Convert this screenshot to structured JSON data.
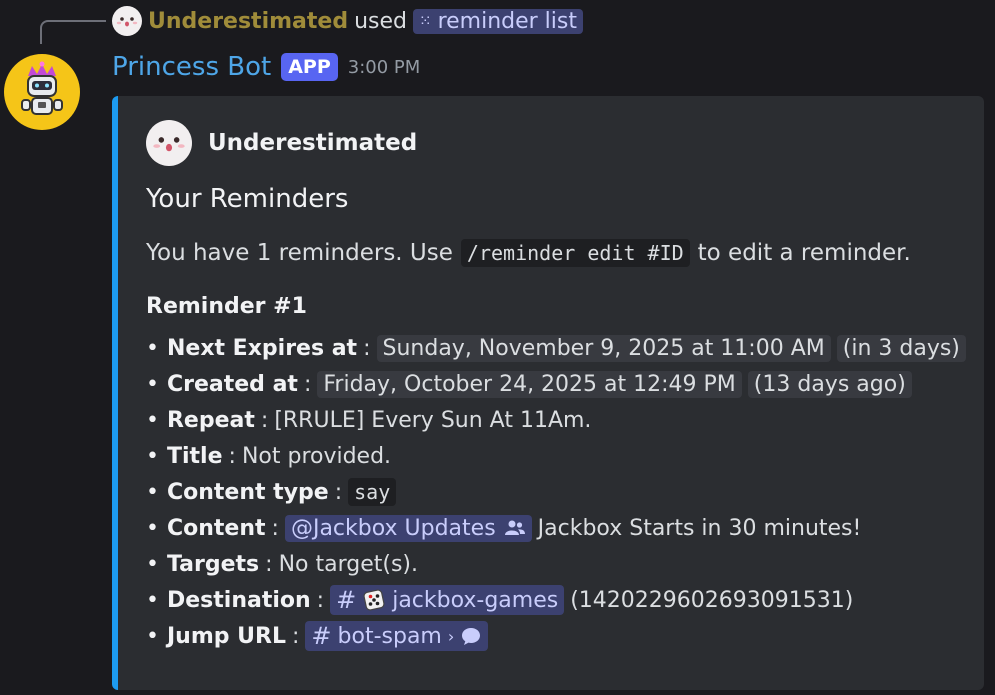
{
  "reply": {
    "username": "Underestimated",
    "used_text": "used",
    "command": "reminder list"
  },
  "message": {
    "bot_name": "Princess Bot",
    "badge": "APP",
    "time": "3:00 PM"
  },
  "embed": {
    "author": "Underestimated",
    "title": "Your Reminders",
    "desc_before": "You have 1 reminders. Use",
    "desc_code": "/reminder edit #ID",
    "desc_after": "to edit a reminder.",
    "field_name": "Reminder #1",
    "items": {
      "next": {
        "label": "Next Expires at",
        "value": "Sunday, November 9, 2025 at 11:00 AM",
        "relative": "in 3 days"
      },
      "created": {
        "label": "Created at",
        "value": "Friday, October 24, 2025 at 12:49 PM",
        "relative": "13 days ago"
      },
      "repeat": {
        "label": "Repeat",
        "value": "[RRULE] Every Sun At 11Am."
      },
      "title": {
        "label": "Title",
        "value": "Not provided."
      },
      "content_type": {
        "label": "Content type",
        "value": "say"
      },
      "content": {
        "label": "Content",
        "mention": "@Jackbox Updates",
        "text": "Jackbox Starts in 30 minutes!"
      },
      "targets": {
        "label": "Targets",
        "value": "No target(s)."
      },
      "destination": {
        "label": "Destination",
        "channel": "jackbox-games",
        "id": "(1420229602693091531)"
      },
      "jump": {
        "label": "Jump URL",
        "channel": "bot-spam"
      }
    }
  },
  "colors": {
    "accent": "#1d9bf0",
    "bot_name": "#4ea6e8",
    "badge": "#5865f2",
    "mention_bg": "#3c4170",
    "reply_name": "#a08c3a",
    "avatar_bg": "#f5c518"
  },
  "icons": {
    "command": "slash-command-icon",
    "mention": "role-members-icon",
    "channel": "hash-icon",
    "dice": "dice-emoji-icon",
    "thread": "thread-bubble-icon"
  }
}
